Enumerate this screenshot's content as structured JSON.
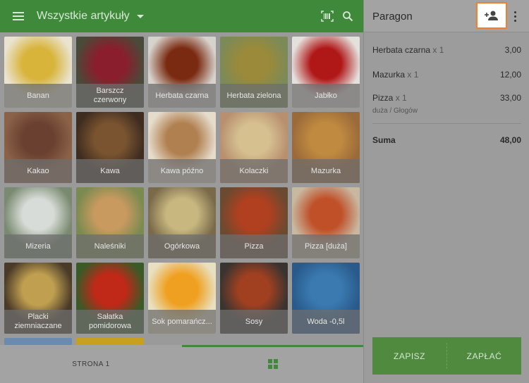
{
  "header": {
    "menu_icon": "hamburger-icon",
    "category_title": "Wszystkie artykuły",
    "barcode_icon": "barcode-scan-icon",
    "search_icon": "search-icon"
  },
  "products": [
    {
      "label": "Banan",
      "color": "#d8b43a",
      "bg": "#e9e3cf"
    },
    {
      "label": "Barszcz czerwony",
      "color": "#8a1e2c",
      "bg": "#4a4a3a"
    },
    {
      "label": "Herbata czarna",
      "color": "#7a2a10",
      "bg": "#d6d2cc"
    },
    {
      "label": "Herbata zielona",
      "color": "#9a8a3a",
      "bg": "#7c8a58"
    },
    {
      "label": "Jabłko",
      "color": "#b01818",
      "bg": "#e4e0dc"
    },
    {
      "label": "Kakao",
      "color": "#6a4030",
      "bg": "#8a6248"
    },
    {
      "label": "Kawa",
      "color": "#7a5430",
      "bg": "#3e2c20"
    },
    {
      "label": "Kawa późno",
      "color": "#b08050",
      "bg": "#e6dccc"
    },
    {
      "label": "Kolaczki",
      "color": "#d6c090",
      "bg": "#b89070"
    },
    {
      "label": "Mazurka",
      "color": "#c08a40",
      "bg": "#9a6a3a"
    },
    {
      "label": "Mizeria",
      "color": "#d8dcd8",
      "bg": "#7a8a70"
    },
    {
      "label": "Naleśniki",
      "color": "#c89a60",
      "bg": "#7a8a50"
    },
    {
      "label": "Ogórkowa",
      "color": "#c8b880",
      "bg": "#7a6a4a"
    },
    {
      "label": "Pizza",
      "color": "#b04020",
      "bg": "#6a4a30"
    },
    {
      "label": "Pizza [duża]",
      "color": "#c05028",
      "bg": "#c8b8a0"
    },
    {
      "label": "Placki ziemniaczane",
      "color": "#c0a050",
      "bg": "#4a3a28"
    },
    {
      "label": "Sałatka pomidorowa",
      "color": "#c02818",
      "bg": "#3a5a28"
    },
    {
      "label": "Sok pomarańcz...",
      "color": "#f0a020",
      "bg": "#e8e0c0"
    },
    {
      "label": "Sosy",
      "color": "#a04020",
      "bg": "#3a3430"
    },
    {
      "label": "Woda -0,5l",
      "color": "#3a7ab0",
      "bg": "#2a5a8a"
    }
  ],
  "partial_tiles": [
    {
      "color": "#6a8ab0"
    },
    {
      "color": "#c8a020"
    }
  ],
  "bottom_nav": {
    "page_label": "STRONA 1",
    "grid_icon": "grid-view-icon"
  },
  "receipt": {
    "title": "Paragon",
    "add_customer_icon": "add-customer-icon",
    "more_icon": "more-vert-icon",
    "items": [
      {
        "name": "Herbata czarna",
        "qty": "x 1",
        "price": "3,00",
        "note": ""
      },
      {
        "name": "Mazurka",
        "qty": "x 1",
        "price": "12,00",
        "note": ""
      },
      {
        "name": "Pizza",
        "qty": "x 1",
        "price": "33,00",
        "note": "duża / Głogów"
      }
    ],
    "sum_label": "Suma",
    "sum_value": "48,00",
    "save_label": "ZAPISZ",
    "pay_label": "ZAPŁAĆ"
  },
  "colors": {
    "primary_green": "#3f8a3a",
    "highlight_orange": "#f08030"
  }
}
